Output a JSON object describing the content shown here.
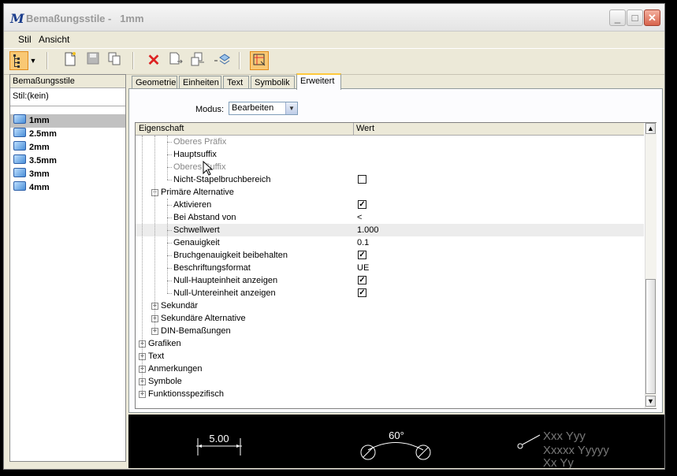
{
  "window": {
    "title": "Bemaßungsstile -   1mm",
    "buttons": {
      "minimize": "_",
      "maximize": "□",
      "close": "✕"
    }
  },
  "menu": {
    "items": [
      {
        "label": "Stil"
      },
      {
        "label": "Ansicht"
      }
    ]
  },
  "toolbar": {
    "icons": [
      "tree-view-icon",
      "dropdown-arrow-icon",
      "new-file-icon",
      "save-icon",
      "copy-icon",
      "delete-icon",
      "import-icon",
      "export-icon",
      "update-icon",
      "dimension-tool-icon"
    ]
  },
  "left_panel": {
    "header": "Bemaßungsstile",
    "current": "Stil:(kein)",
    "styles": [
      "1mm",
      "2.5mm",
      "2mm",
      "3.5mm",
      "3mm",
      "4mm"
    ],
    "selected_index": 0
  },
  "tabs": [
    "Geometrie",
    "Einheiten",
    "Text",
    "Symbolik",
    "Erweitert"
  ],
  "active_tab": "Erweitert",
  "modus": {
    "label": "Modus:",
    "value": "Bearbeiten"
  },
  "grid": {
    "col_property": "Eigenschaft",
    "col_value": "Wert",
    "rows": [
      {
        "name": "Oberes Präfix",
        "level": 2,
        "dim": true,
        "type": "text",
        "value": ""
      },
      {
        "name": "Hauptsuffix",
        "level": 2,
        "dim": false,
        "type": "text",
        "value": ""
      },
      {
        "name": "Oberes Suffix",
        "level": 2,
        "dim": true,
        "type": "text",
        "value": ""
      },
      {
        "name": "Nicht-Stapelbruchbereich",
        "level": 2,
        "dim": false,
        "type": "check",
        "checked": false
      },
      {
        "name": "Primäre Alternative",
        "level": 1,
        "dim": false,
        "type": "group",
        "expanded": true
      },
      {
        "name": "Aktivieren",
        "level": 2,
        "dim": false,
        "type": "check",
        "checked": true
      },
      {
        "name": "Bei Abstand von",
        "level": 2,
        "dim": false,
        "type": "text",
        "value": "<"
      },
      {
        "name": "Schwellwert",
        "level": 2,
        "dim": false,
        "type": "text",
        "value": "1.000",
        "selected": true
      },
      {
        "name": "Genauigkeit",
        "level": 2,
        "dim": false,
        "type": "text",
        "value": "0.1"
      },
      {
        "name": "Bruchgenauigkeit beibehalten",
        "level": 2,
        "dim": false,
        "type": "check",
        "checked": true
      },
      {
        "name": "Beschriftungsformat",
        "level": 2,
        "dim": false,
        "type": "text",
        "value": "UE"
      },
      {
        "name": "Null-Haupteinheit anzeigen",
        "level": 2,
        "dim": false,
        "type": "check",
        "checked": true
      },
      {
        "name": "Null-Untereinheit anzeigen",
        "level": 2,
        "dim": false,
        "type": "check",
        "checked": true
      },
      {
        "name": "Sekundär",
        "level": 1,
        "dim": false,
        "type": "group",
        "expanded": false
      },
      {
        "name": "Sekundäre Alternative",
        "level": 1,
        "dim": false,
        "type": "group",
        "expanded": false
      },
      {
        "name": "DIN-Bemaßungen",
        "level": 1,
        "dim": false,
        "type": "group",
        "expanded": false
      },
      {
        "name": "Grafiken",
        "level": 0,
        "dim": false,
        "type": "group",
        "expanded": false
      },
      {
        "name": "Text",
        "level": 0,
        "dim": false,
        "type": "group",
        "expanded": false
      },
      {
        "name": "Anmerkungen",
        "level": 0,
        "dim": false,
        "type": "group",
        "expanded": false
      },
      {
        "name": "Symbole",
        "level": 0,
        "dim": false,
        "type": "group",
        "expanded": false
      },
      {
        "name": "Funktionsspezifisch",
        "level": 0,
        "dim": false,
        "type": "group",
        "expanded": false
      }
    ]
  },
  "preview": {
    "linear_label": "5.00",
    "angle_label": "60°",
    "note_lines": [
      "Xxx Yyy",
      "Xxxxx Yyyyy",
      "Xx Yy"
    ]
  }
}
